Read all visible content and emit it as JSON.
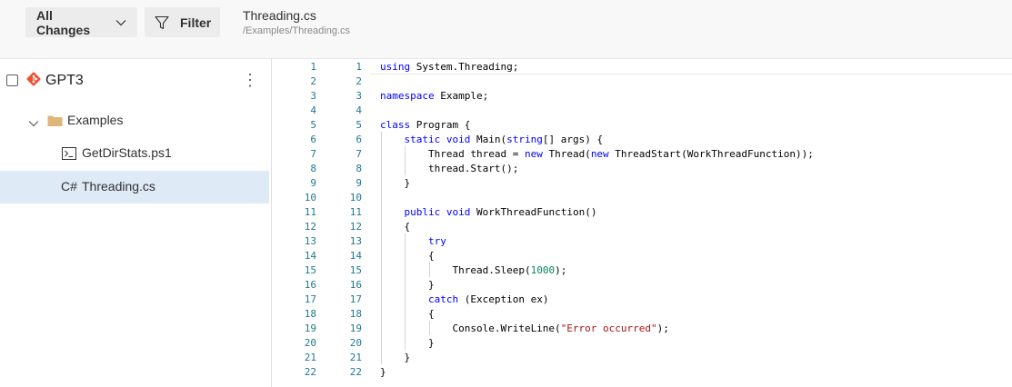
{
  "toolbar": {
    "changes_label": "All Changes",
    "filter_label": "Filter",
    "file_title": "Threading.cs",
    "file_path": "/Examples/Threading.cs"
  },
  "sidebar": {
    "repo_name": "GPT3",
    "more_glyph": "⋮",
    "folder_label": "Examples",
    "files": [
      {
        "label": "GetDirStats.ps1",
        "icon": "powershell-file-icon"
      },
      {
        "label": "Threading.cs",
        "icon": "csharp-file-icon",
        "icon_text": "C#",
        "selected": true
      }
    ]
  },
  "code": {
    "left_line_numbers": [
      "1",
      "2",
      "3",
      "4",
      "5",
      "6",
      "7",
      "8",
      "9",
      "10",
      "11",
      "12",
      "13",
      "14",
      "15",
      "16",
      "17",
      "18",
      "19",
      "20",
      "21",
      "22"
    ],
    "right_line_numbers": [
      "1",
      "2",
      "3",
      "4",
      "5",
      "6",
      "7",
      "8",
      "9",
      "10",
      "11",
      "12",
      "13",
      "14",
      "15",
      "16",
      "17",
      "18",
      "19",
      "20",
      "21",
      "22"
    ],
    "lines": [
      "using System.Threading;",
      "",
      "namespace Example;",
      "",
      "class Program {",
      "    static void Main(string[] args) {",
      "        Thread thread = new Thread(new ThreadStart(WorkThreadFunction));",
      "        thread.Start();",
      "    }",
      "",
      "    public void WorkThreadFunction()",
      "    {",
      "        try",
      "        {",
      "            Thread.Sleep(1000);",
      "        }",
      "        catch (Exception ex)",
      "        {",
      "            Console.WriteLine(\"Error occurred\");",
      "        }",
      "    }",
      "}"
    ]
  },
  "colors": {
    "line_number": "#237893",
    "keyword": "#0000ff",
    "string": "#a31515",
    "number": "#098658",
    "selection": "#dfeaf7",
    "git_icon": "#f05133",
    "folder": "#dcb67a"
  }
}
